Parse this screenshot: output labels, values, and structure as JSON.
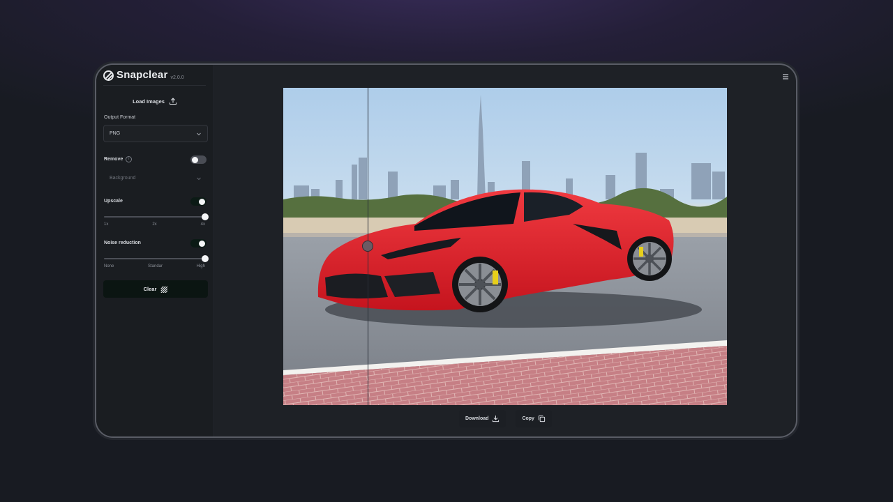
{
  "app": {
    "name": "Snapclear",
    "version": "v2.0.0"
  },
  "sidebar": {
    "load_label": "Load Images",
    "output_format": {
      "label": "Output Format",
      "value": "PNG"
    },
    "remove": {
      "label": "Remove",
      "enabled": false,
      "target_placeholder": "Background"
    },
    "upscale": {
      "label": "Upscale",
      "enabled": true,
      "value": 1.0,
      "ticks": [
        "1x",
        "2x",
        "4x"
      ]
    },
    "noise": {
      "label": "Noise reduction",
      "enabled": true,
      "value": 1.0,
      "ticks": [
        "None",
        "Standar",
        "High"
      ]
    },
    "clear_label": "Clear"
  },
  "preview": {
    "compare_split": 0.19
  },
  "actions": {
    "download_label": "Download",
    "copy_label": "Copy"
  },
  "icons": [
    "brand-logo-icon",
    "upload-icon",
    "info-icon",
    "chevron-down-icon",
    "hatch-icon",
    "menu-icon",
    "download-icon",
    "copy-icon"
  ],
  "colors": {
    "accent_dark": "#0b1512",
    "car_red": "#e0202a"
  }
}
